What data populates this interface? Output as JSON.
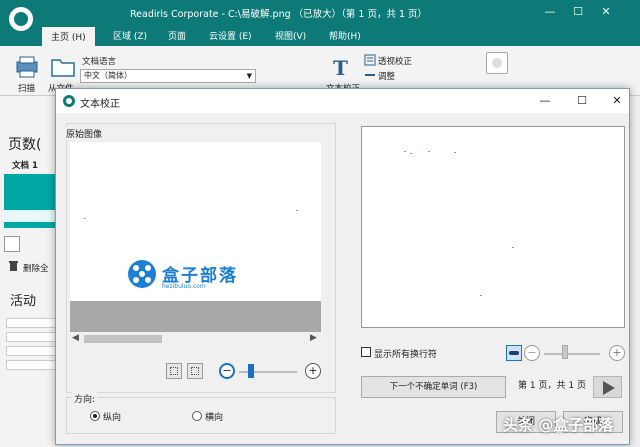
{
  "app": {
    "title": "Readiris Corporate - C:\\易破解.png （已放大）（第 1 页，共 1 页）",
    "tabs": [
      "主页 (H)",
      "区域 (Z)",
      "页面",
      "云设置 (E)",
      "视图(V)",
      "帮助(H)"
    ],
    "ribbon": {
      "scan_label": "扫描",
      "from_file_label": "从文件",
      "doc_language_label": "文档语言",
      "doc_language_value": "中文（简体）",
      "text_correct_label": "文本校正",
      "perspective_label": "透视校正",
      "adjust_label": "调整"
    },
    "left_panel": {
      "pages_label": "页数(",
      "doc_label": "文档 1",
      "delete_all_label": "删除全",
      "activity_label": "活动"
    }
  },
  "dialog": {
    "title": "文本校正",
    "original_image_label": "原始图像",
    "logo": {
      "name": "盒子部落",
      "url": "hezibuluo.com"
    },
    "orientation": {
      "label": "方向:",
      "portrait_label": "纵向",
      "landscape_label": "横向",
      "selected": "portrait"
    },
    "show_all_breaks_label": "显示所有换行符",
    "show_all_breaks_checked": false,
    "next_uncertain_label": "下一个不确定单词 (F3)",
    "page_info": "第 1 页，共 1 页",
    "bottom_left_button": "关闭",
    "bottom_right_button": "完成"
  },
  "watermark": "头条 @盒子部落",
  "colors": {
    "brand": "#0e7a78",
    "logo_blue": "#1d7fd4"
  }
}
